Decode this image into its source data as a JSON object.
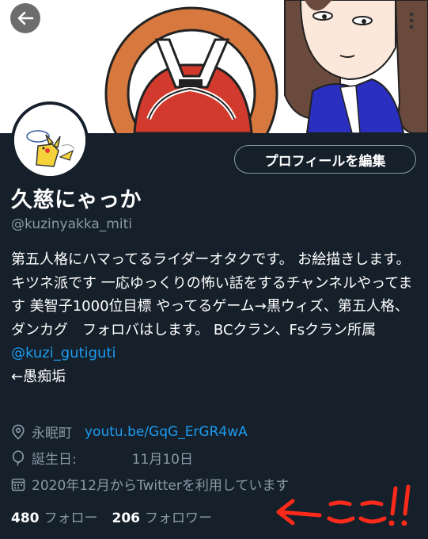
{
  "profile": {
    "edit_button_label": "プロフィールを編集",
    "display_name": "久慈にゃっか",
    "handle": "@kuzinyakka_miti",
    "bio_text": "第五人格にハマってるライダーオタクです。 お絵描きします。 キツネ派です 一応ゆっくりの怖い話をするチャンネルやってます 美智子1000位目標 やってるゲーム→黒ウィズ、第五人格、ダンカグ　フォロバはします。 BCクラン、Fsクラン所属 ",
    "bio_mention": "@kuzi_gutiguti",
    "bio_tail": "←愚痴垢",
    "location": "永眠町",
    "website": "youtu.be/GqG_ErGR4wA",
    "birthday_label": "誕生日:",
    "birthday_value": "11月10日",
    "joined": "2020年12月からTwitterを利用しています",
    "following_count": "480",
    "following_label": "フォロー",
    "followers_count": "206",
    "followers_label": "フォロワー"
  },
  "annotation": {
    "text": "←ここ‼",
    "color": "#ff2a1a"
  },
  "icons": [
    "back-arrow-icon",
    "more-icon",
    "location-pin-icon",
    "balloon-icon",
    "calendar-icon"
  ],
  "colors": {
    "background": "#15202b",
    "secondary_text": "#8b98a5",
    "accent": "#1d9bf0"
  }
}
